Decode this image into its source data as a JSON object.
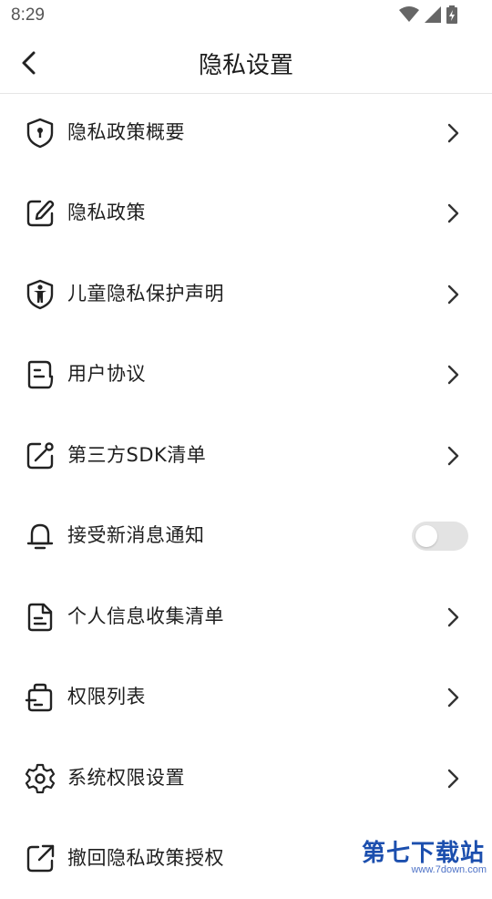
{
  "status_bar": {
    "time": "8:29"
  },
  "header": {
    "title": "隐私设置"
  },
  "items": [
    {
      "label": "隐私政策概要",
      "icon": "shield-lock-icon",
      "control": "chevron"
    },
    {
      "label": "隐私政策",
      "icon": "edit-note-icon",
      "control": "chevron"
    },
    {
      "label": "儿童隐私保护声明",
      "icon": "child-shield-icon",
      "control": "chevron"
    },
    {
      "label": "用户协议",
      "icon": "agreement-document-icon",
      "control": "chevron"
    },
    {
      "label": "第三方SDK清单",
      "icon": "sdk-edit-icon",
      "control": "chevron"
    },
    {
      "label": "接受新消息通知",
      "icon": "bell-icon",
      "control": "toggle",
      "toggle_on": false
    },
    {
      "label": "个人信息收集清单",
      "icon": "document-list-icon",
      "control": "chevron"
    },
    {
      "label": "权限列表",
      "icon": "permission-bag-icon",
      "control": "chevron"
    },
    {
      "label": "系统权限设置",
      "icon": "gear-icon",
      "control": "chevron"
    },
    {
      "label": "撤回隐私政策授权",
      "icon": "external-share-icon",
      "control": "chevron"
    }
  ],
  "watermark": {
    "text": "第七下载站",
    "url": "www.7down.com"
  },
  "colors": {
    "text": "#1f1f1f",
    "divider": "#e6e6e6",
    "toggle_off": "#e3e3e3",
    "watermark": "#1c4fae"
  }
}
